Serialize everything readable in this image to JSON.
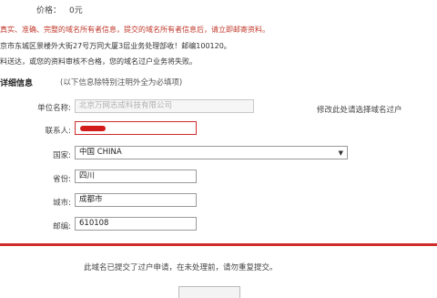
{
  "price": {
    "label": "价格：",
    "value": "0元"
  },
  "notices": {
    "red": "真实、准确、完整的域名所有者信息，提交的域名所有者信息后，请立即邮寄资料。",
    "line1": "京市东城区景楼外大街27号万同大厦3层业务处理部收！邮编100120。",
    "line2": "料送达，或您的资料审核不合格，您的域名过户业务将失败。"
  },
  "section": {
    "title": "详细信息",
    "hint": "(以下信息除特别注明外全为必填项)"
  },
  "form": {
    "unit_name": {
      "label": "单位名称:",
      "value": "北京万网志成科技有限公司"
    },
    "contact": {
      "label": "联系人:",
      "value": ""
    },
    "country": {
      "label": "国家:",
      "value": "中国 CHINA"
    },
    "province": {
      "label": "省份:",
      "value": "四川"
    },
    "city": {
      "label": "城市:",
      "value": "成都市"
    },
    "postcode": {
      "label": "邮编:",
      "value": "610108"
    }
  },
  "modify_link": "修改此处请选择域名过户",
  "bottom_message": "此域名已提交了过户申请，在未处理前，请勿重复提交。",
  "colors": {
    "accent": "#cf2b2b"
  },
  "icons": {
    "select_arrow": "chevron-down-icon"
  }
}
